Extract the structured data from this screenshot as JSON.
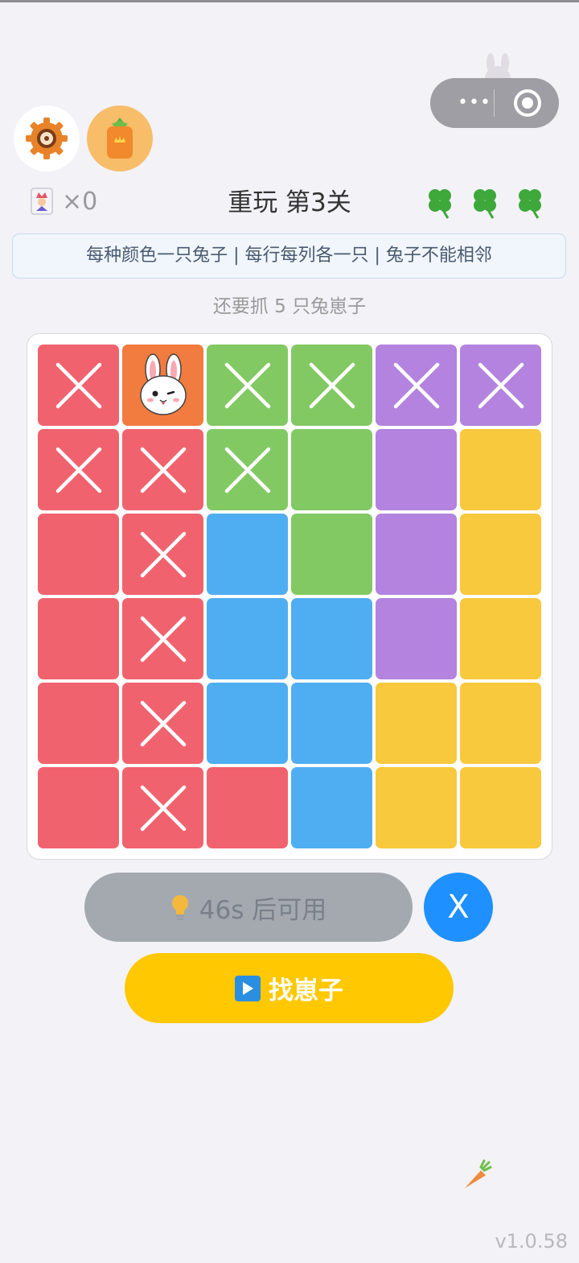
{
  "header": {
    "lives_count": "×0",
    "level_title": "重玩 第3关",
    "clover_icons": [
      "clover-icon",
      "clover-icon",
      "clover-icon"
    ]
  },
  "rules_text": "每种颜色一只兔子 | 每行每列各一只 | 兔子不能相邻",
  "remaining_text": "还要抓 5 只兔崽子",
  "colors": {
    "red": "#f0636e",
    "orange": "#f27b3f",
    "green": "#82c964",
    "purple": "#b383df",
    "yellow": "#f8c83d",
    "blue": "#4faef2",
    "accent_blue": "#1e90ff",
    "find_yellow": "#ffc800"
  },
  "board": {
    "rows": 6,
    "cols": 6,
    "cells": [
      [
        {
          "color": "red",
          "mark": "x"
        },
        {
          "color": "orange",
          "mark": "bunny"
        },
        {
          "color": "green",
          "mark": "x"
        },
        {
          "color": "green",
          "mark": "x"
        },
        {
          "color": "purple",
          "mark": "x"
        },
        {
          "color": "purple",
          "mark": "x"
        }
      ],
      [
        {
          "color": "red",
          "mark": "x"
        },
        {
          "color": "red",
          "mark": "x"
        },
        {
          "color": "green",
          "mark": "x"
        },
        {
          "color": "green",
          "mark": ""
        },
        {
          "color": "purple",
          "mark": ""
        },
        {
          "color": "yellow",
          "mark": ""
        }
      ],
      [
        {
          "color": "red",
          "mark": ""
        },
        {
          "color": "red",
          "mark": "x"
        },
        {
          "color": "blue",
          "mark": ""
        },
        {
          "color": "green",
          "mark": ""
        },
        {
          "color": "purple",
          "mark": ""
        },
        {
          "color": "yellow",
          "mark": ""
        }
      ],
      [
        {
          "color": "red",
          "mark": ""
        },
        {
          "color": "red",
          "mark": "x"
        },
        {
          "color": "blue",
          "mark": ""
        },
        {
          "color": "blue",
          "mark": ""
        },
        {
          "color": "purple",
          "mark": ""
        },
        {
          "color": "yellow",
          "mark": ""
        }
      ],
      [
        {
          "color": "red",
          "mark": ""
        },
        {
          "color": "red",
          "mark": "x"
        },
        {
          "color": "blue",
          "mark": ""
        },
        {
          "color": "blue",
          "mark": ""
        },
        {
          "color": "yellow",
          "mark": ""
        },
        {
          "color": "yellow",
          "mark": ""
        }
      ],
      [
        {
          "color": "red",
          "mark": ""
        },
        {
          "color": "red",
          "mark": "x"
        },
        {
          "color": "red",
          "mark": ""
        },
        {
          "color": "blue",
          "mark": ""
        },
        {
          "color": "yellow",
          "mark": ""
        },
        {
          "color": "yellow",
          "mark": ""
        }
      ]
    ]
  },
  "buttons": {
    "hint_label": "46s 后可用",
    "hint_icon": "lightbulb-icon",
    "close_label": "X",
    "find_label": "找崽子",
    "find_icon": "play-icon"
  },
  "version": "v1.0.58"
}
